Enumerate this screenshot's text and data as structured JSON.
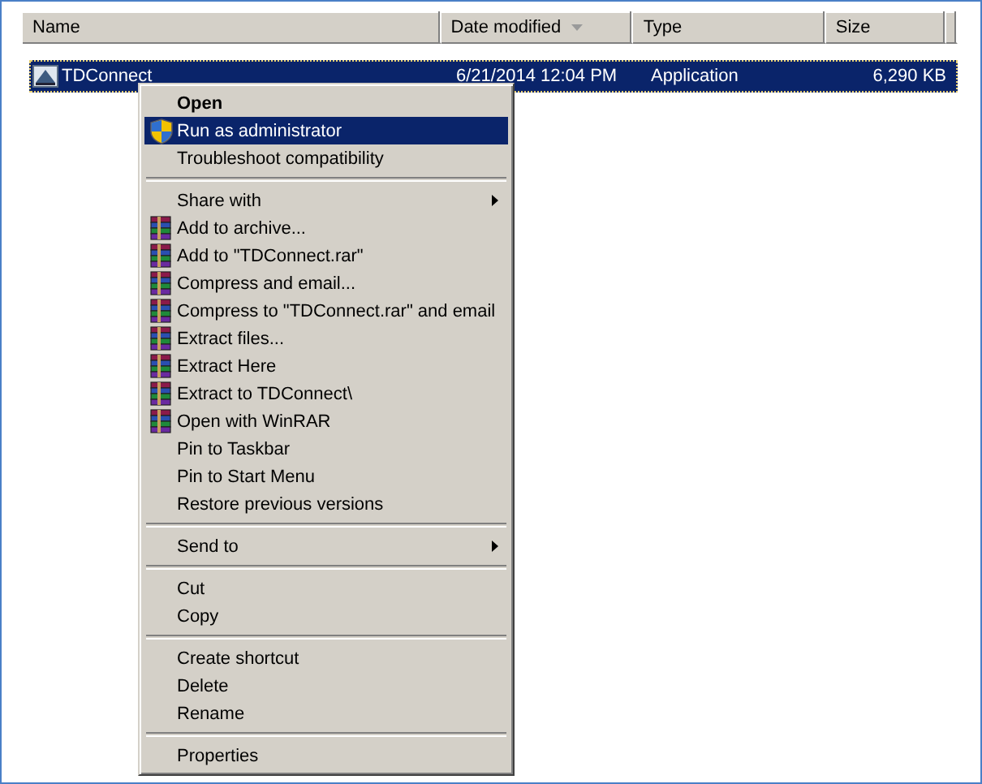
{
  "columns": [
    {
      "label": "Name",
      "sorted": false
    },
    {
      "label": "Date modified",
      "sorted": true
    },
    {
      "label": "Type",
      "sorted": false
    },
    {
      "label": "Size",
      "sorted": false
    }
  ],
  "rows": [
    {
      "name": "TDConnect",
      "date": "6/21/2014 12:04 PM",
      "type": "Application",
      "size": "6,290 KB",
      "selected": true
    }
  ],
  "context_menu": [
    {
      "kind": "item",
      "label": "Open",
      "default": true,
      "selected": false
    },
    {
      "kind": "shield",
      "label": "Run as administrator",
      "selected": true
    },
    {
      "kind": "item",
      "label": "Troubleshoot compatibility",
      "selected": false
    },
    {
      "kind": "separator"
    },
    {
      "kind": "item",
      "label": "Share with",
      "submenu": true,
      "selected": false
    },
    {
      "kind": "archive",
      "label": "Add to archive...",
      "selected": false
    },
    {
      "kind": "archive",
      "label": "Add to \"TDConnect.rar\"",
      "selected": false
    },
    {
      "kind": "archive",
      "label": "Compress and email...",
      "selected": false
    },
    {
      "kind": "archive",
      "label": "Compress to \"TDConnect.rar\" and email",
      "selected": false
    },
    {
      "kind": "archive",
      "label": "Extract files...",
      "selected": false
    },
    {
      "kind": "archive",
      "label": "Extract Here",
      "selected": false
    },
    {
      "kind": "archive",
      "label": "Extract to TDConnect\\",
      "selected": false
    },
    {
      "kind": "archive",
      "label": "Open with WinRAR",
      "selected": false
    },
    {
      "kind": "item",
      "label": "Pin to Taskbar",
      "selected": false
    },
    {
      "kind": "item",
      "label": "Pin to Start Menu",
      "selected": false
    },
    {
      "kind": "item",
      "label": "Restore previous versions",
      "selected": false
    },
    {
      "kind": "separator"
    },
    {
      "kind": "item",
      "label": "Send to",
      "submenu": true,
      "selected": false
    },
    {
      "kind": "separator"
    },
    {
      "kind": "item",
      "label": "Cut",
      "selected": false
    },
    {
      "kind": "item",
      "label": "Copy",
      "selected": false
    },
    {
      "kind": "separator"
    },
    {
      "kind": "item",
      "label": "Create shortcut",
      "selected": false
    },
    {
      "kind": "item",
      "label": "Delete",
      "selected": false
    },
    {
      "kind": "item",
      "label": "Rename",
      "selected": false
    },
    {
      "kind": "separator"
    },
    {
      "kind": "item",
      "label": "Properties",
      "selected": false
    }
  ]
}
